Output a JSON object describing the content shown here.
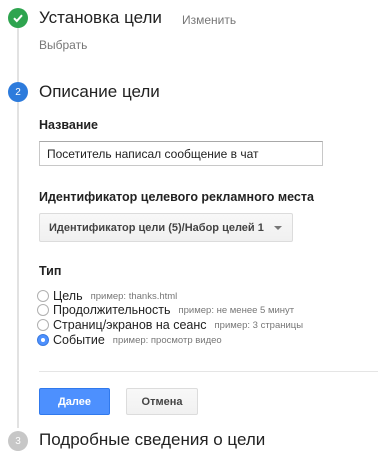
{
  "step1": {
    "title": "Установка цели",
    "edit_label": "Изменить",
    "selected_value": "Выбрать"
  },
  "step2": {
    "number": "2",
    "title": "Описание цели",
    "name_label": "Название",
    "name_value": "Посетитель написал сообщение в чат",
    "slot_label": "Идентификатор целевого рекламного места",
    "slot_value": "Идентификатор цели (5)/Набор целей 1",
    "type_label": "Тип",
    "types": [
      {
        "label": "Цель",
        "hint": "пример: thanks.html",
        "checked": false
      },
      {
        "label": "Продолжительность",
        "hint": "пример: не менее 5 минут",
        "checked": false
      },
      {
        "label": "Страниц/экранов на сеанс",
        "hint": "пример: 3 страницы",
        "checked": false
      },
      {
        "label": "Событие",
        "hint": "пример: просмотр видео",
        "checked": true
      }
    ],
    "next_label": "Далее",
    "cancel_label": "Отмена"
  },
  "step3": {
    "number": "3",
    "title": "Подробные сведения о цели"
  },
  "colors": {
    "accent": "#4d90fe",
    "step_done": "#2ea44f",
    "step_active": "#2d7bdc",
    "step_inactive": "#c7c7c7"
  }
}
